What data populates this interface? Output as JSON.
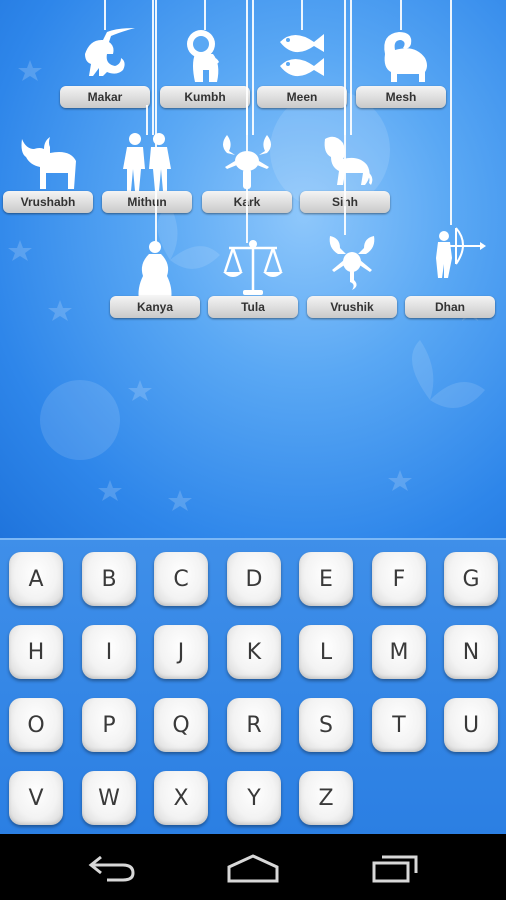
{
  "zodiac_signs": [
    {
      "label": "Makar",
      "icon": "capricorn-icon"
    },
    {
      "label": "Kumbh",
      "icon": "aquarius-icon"
    },
    {
      "label": "Meen",
      "icon": "pisces-icon"
    },
    {
      "label": "Mesh",
      "icon": "aries-icon"
    },
    {
      "label": "Vrushabh",
      "icon": "taurus-icon"
    },
    {
      "label": "Mithun",
      "icon": "gemini-icon"
    },
    {
      "label": "Kark",
      "icon": "cancer-icon"
    },
    {
      "label": "Sinh",
      "icon": "leo-icon"
    },
    {
      "label": "Kanya",
      "icon": "virgo-icon"
    },
    {
      "label": "Tula",
      "icon": "libra-icon"
    },
    {
      "label": "Vrushik",
      "icon": "scorpio-icon"
    },
    {
      "label": "Dhan",
      "icon": "sagittarius-icon"
    }
  ],
  "keyboard": {
    "keys": [
      "A",
      "B",
      "C",
      "D",
      "E",
      "F",
      "G",
      "H",
      "I",
      "J",
      "K",
      "L",
      "M",
      "N",
      "O",
      "P",
      "Q",
      "R",
      "S",
      "T",
      "U",
      "V",
      "W",
      "X",
      "Y",
      "Z"
    ]
  },
  "nav": {
    "back": "back-icon",
    "home": "home-icon",
    "recents": "recent-apps-icon"
  },
  "colors": {
    "sky_blue": "#5aa8f4",
    "keyboard_blue": "#2b7fe3",
    "key_face": "#f3f3f3",
    "label_text": "#333333"
  }
}
